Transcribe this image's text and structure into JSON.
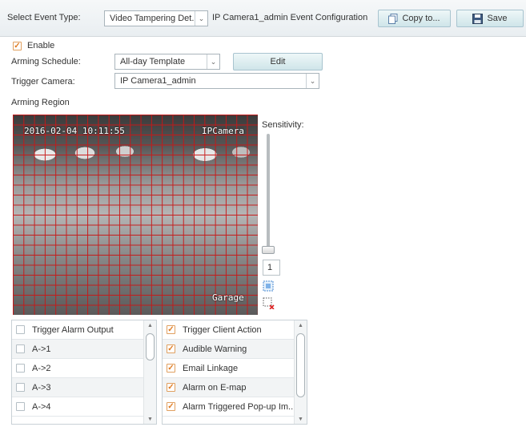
{
  "header": {
    "event_type_label": "Select Event Type:",
    "event_type_value": "Video Tampering Det...",
    "config_title": "IP Camera1_admin Event Configuration",
    "copy_label": "Copy to...",
    "save_label": "Save"
  },
  "form": {
    "enable_label": "Enable",
    "enable_checked": true,
    "arming_schedule_label": "Arming Schedule:",
    "arming_schedule_value": "All-day Template",
    "edit_label": "Edit",
    "trigger_camera_label": "Trigger Camera:",
    "trigger_camera_value": "IP Camera1_admin",
    "arming_region_label": "Arming Region"
  },
  "video": {
    "timestamp": "2016-02-04 10:11:55",
    "camera_name": "IPCamera",
    "location": "Garage"
  },
  "sensitivity": {
    "label": "Sensitivity:",
    "value": "1"
  },
  "alarm_output": {
    "items": [
      {
        "label": "Trigger Alarm Output",
        "checked": false
      },
      {
        "label": "A->1",
        "checked": false
      },
      {
        "label": "A->2",
        "checked": false
      },
      {
        "label": "A->3",
        "checked": false
      },
      {
        "label": "A->4",
        "checked": false
      }
    ]
  },
  "client_action": {
    "items": [
      {
        "label": "Trigger Client Action",
        "checked": true
      },
      {
        "label": "Audible Warning",
        "checked": true
      },
      {
        "label": "Email Linkage",
        "checked": true
      },
      {
        "label": "Alarm on E-map",
        "checked": true
      },
      {
        "label": "Alarm Triggered Pop-up Im...",
        "checked": true
      }
    ]
  },
  "colors": {
    "grid": "#c81818",
    "check_accent": "#e07a20"
  }
}
